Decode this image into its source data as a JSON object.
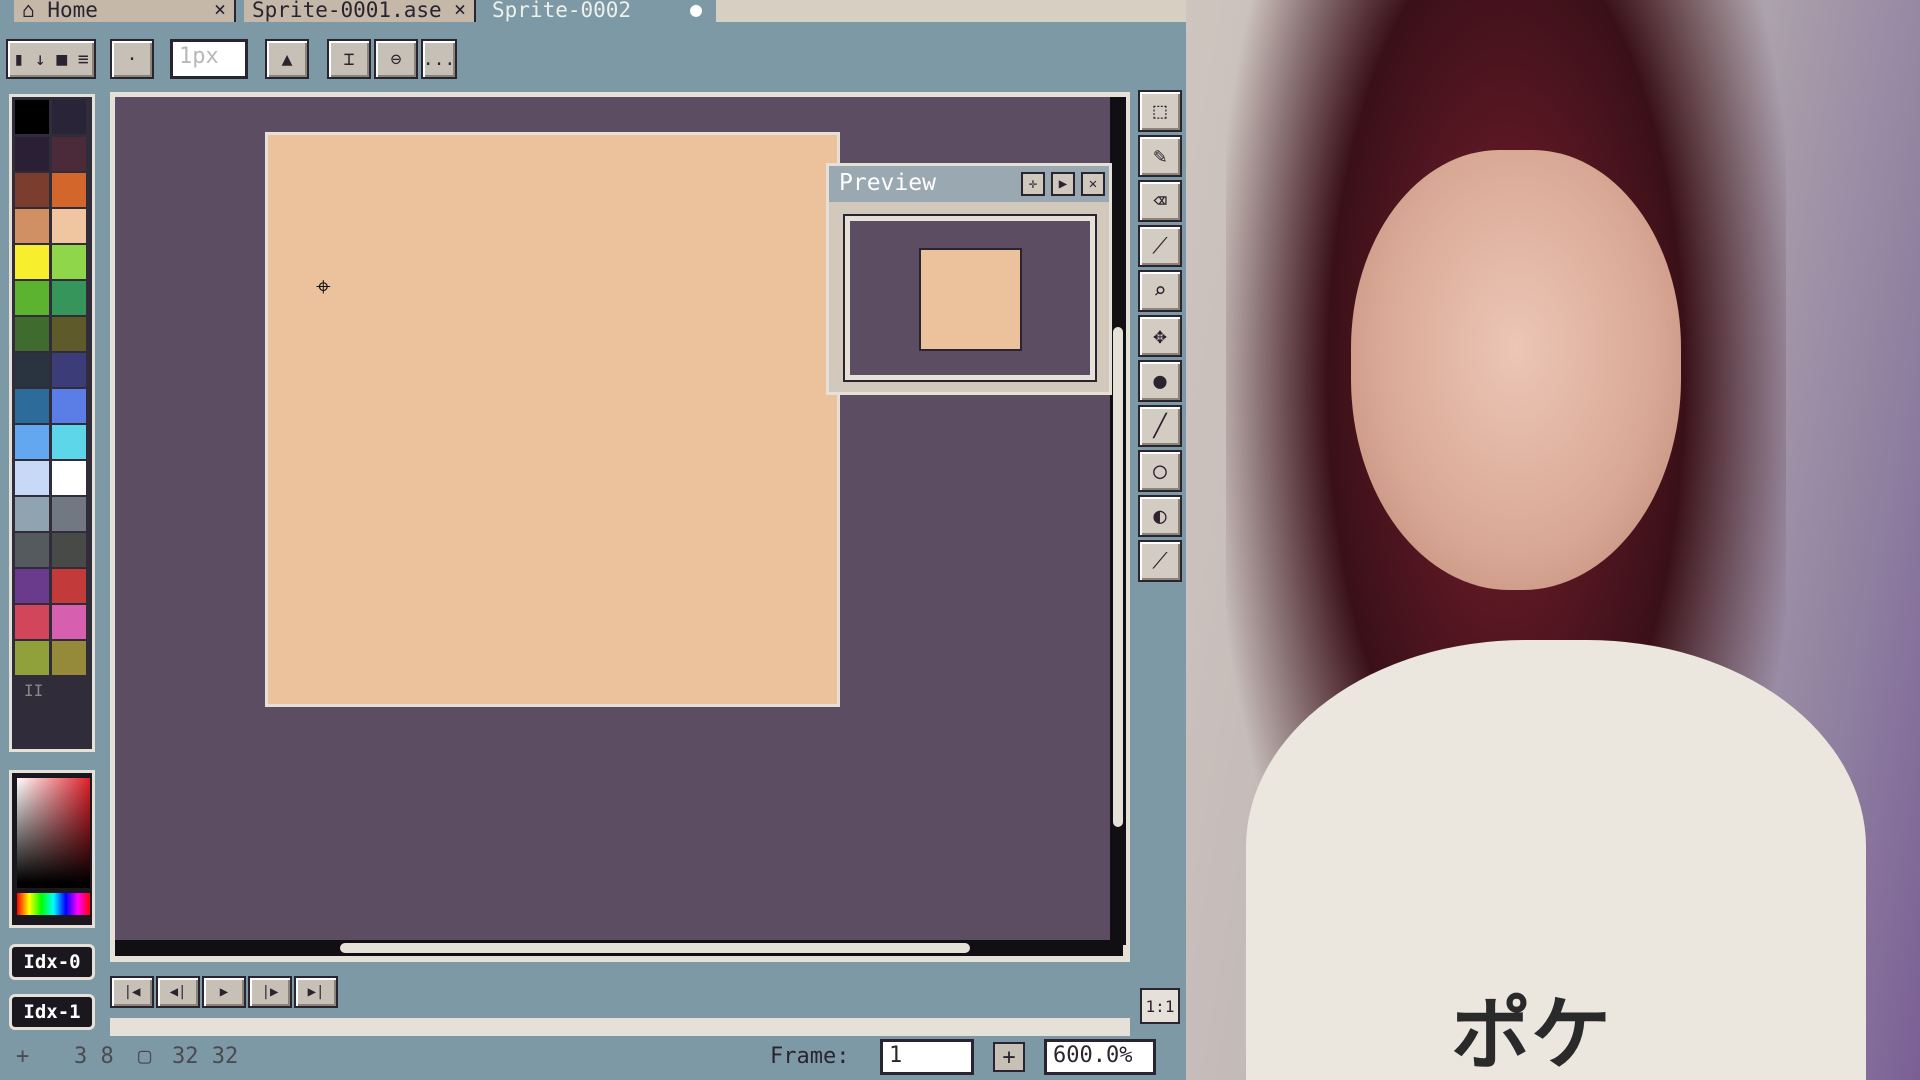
{
  "tabs": [
    {
      "label": "Home",
      "icon": "home-icon",
      "closable": true
    },
    {
      "label": "Sprite-0001.ase",
      "closable": true
    },
    {
      "label": "Sprite-0002",
      "modified": true,
      "active": true
    }
  ],
  "toolbar": {
    "brush_size": "1px",
    "more_label": "..."
  },
  "palette": {
    "colors": [
      "#2b1f36",
      "#4b2a3a",
      "#7a3d2e",
      "#d3662b",
      "#d09064",
      "#f0c6a0",
      "#f7ee2e",
      "#8fd64a",
      "#5bb330",
      "#35955a",
      "#3f6b2e",
      "#5f5a2a",
      "#2a3440",
      "#3b3c78",
      "#2d6b9a",
      "#5a7de6",
      "#63a7f0",
      "#5cd6e8",
      "#c8d8f7",
      "#ffffff",
      "#8fa3b0",
      "#727882",
      "#555a5e",
      "#484a48",
      "#6a3a8c",
      "#c23a3a",
      "#d1465a",
      "#d65fb0",
      "#90a03a",
      "#948a3a"
    ],
    "fg_color": "#000000",
    "bg_color": "#2a2438"
  },
  "color_indices": [
    "Idx-0",
    "Idx-1"
  ],
  "preview": {
    "title": "Preview"
  },
  "colors": {
    "canvas_bg": "#5d4d63",
    "sprite_fill": "#ebc29b",
    "ui_bg": "#7d99a5"
  },
  "tools": [
    "marquee-icon",
    "pencil-icon",
    "eraser-icon",
    "eyedropper-icon",
    "zoom-icon",
    "move-icon",
    "paint-bucket-icon",
    "line-icon",
    "ellipse-icon",
    "contour-icon",
    "blur-icon"
  ],
  "status": {
    "cursor_position": "3 8",
    "sprite_size": "32 32",
    "frame_label": "Frame:",
    "frame_value": "1",
    "zoom": "600.0%",
    "zoom_reset": "1:1"
  },
  "webcam": {
    "shirt_text": "ポケ"
  }
}
